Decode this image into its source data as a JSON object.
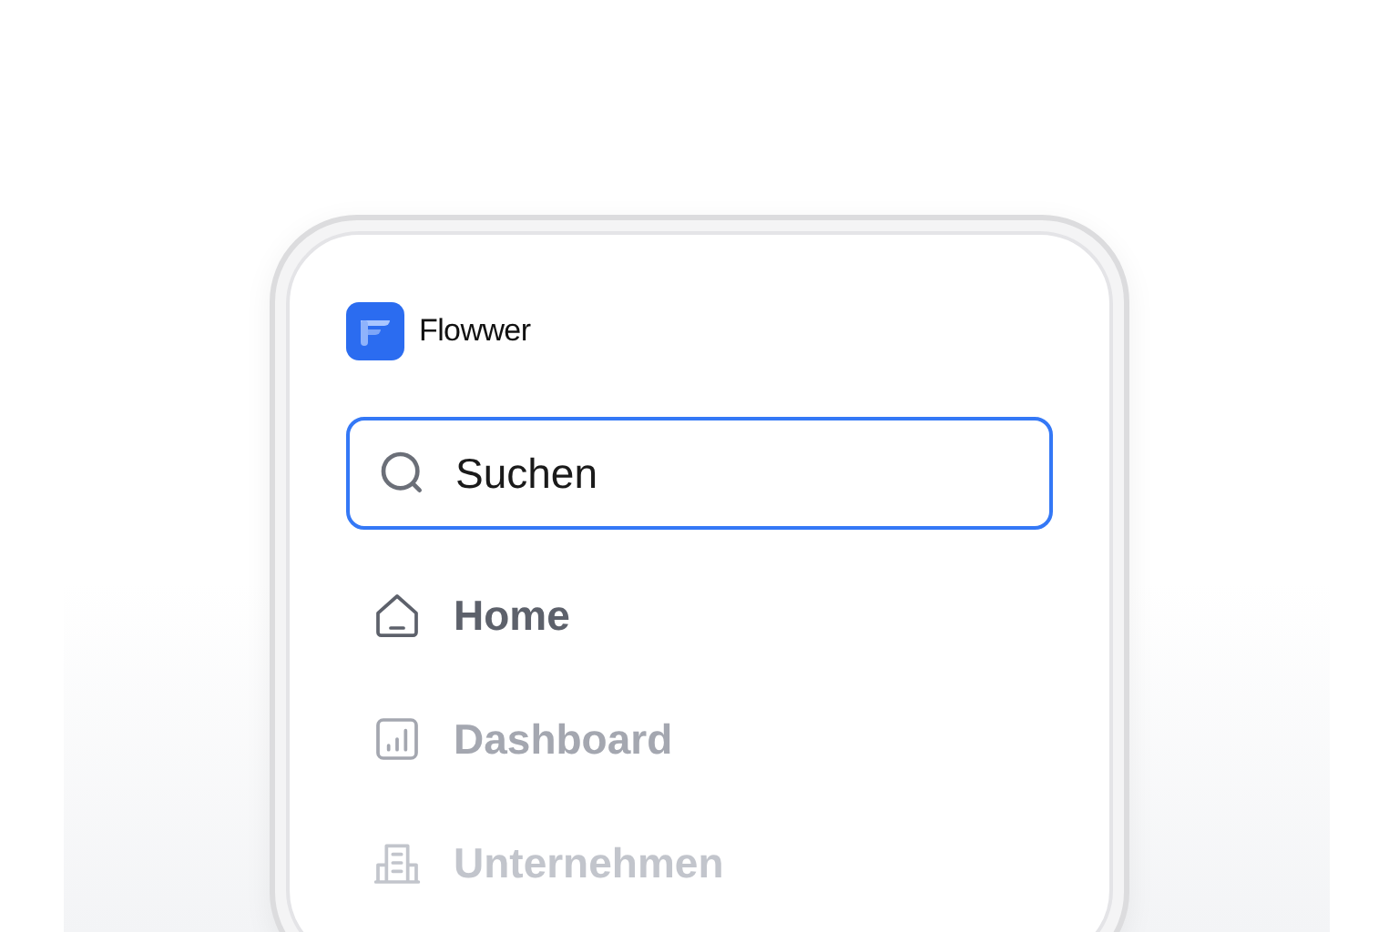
{
  "brand": {
    "name": "Flowwer"
  },
  "search": {
    "placeholder": "Suchen"
  },
  "nav": [
    {
      "label": "Home",
      "kind": "home"
    },
    {
      "label": "Dashboard",
      "kind": "chart"
    },
    {
      "label": "Unternehmen",
      "kind": "building"
    }
  ]
}
